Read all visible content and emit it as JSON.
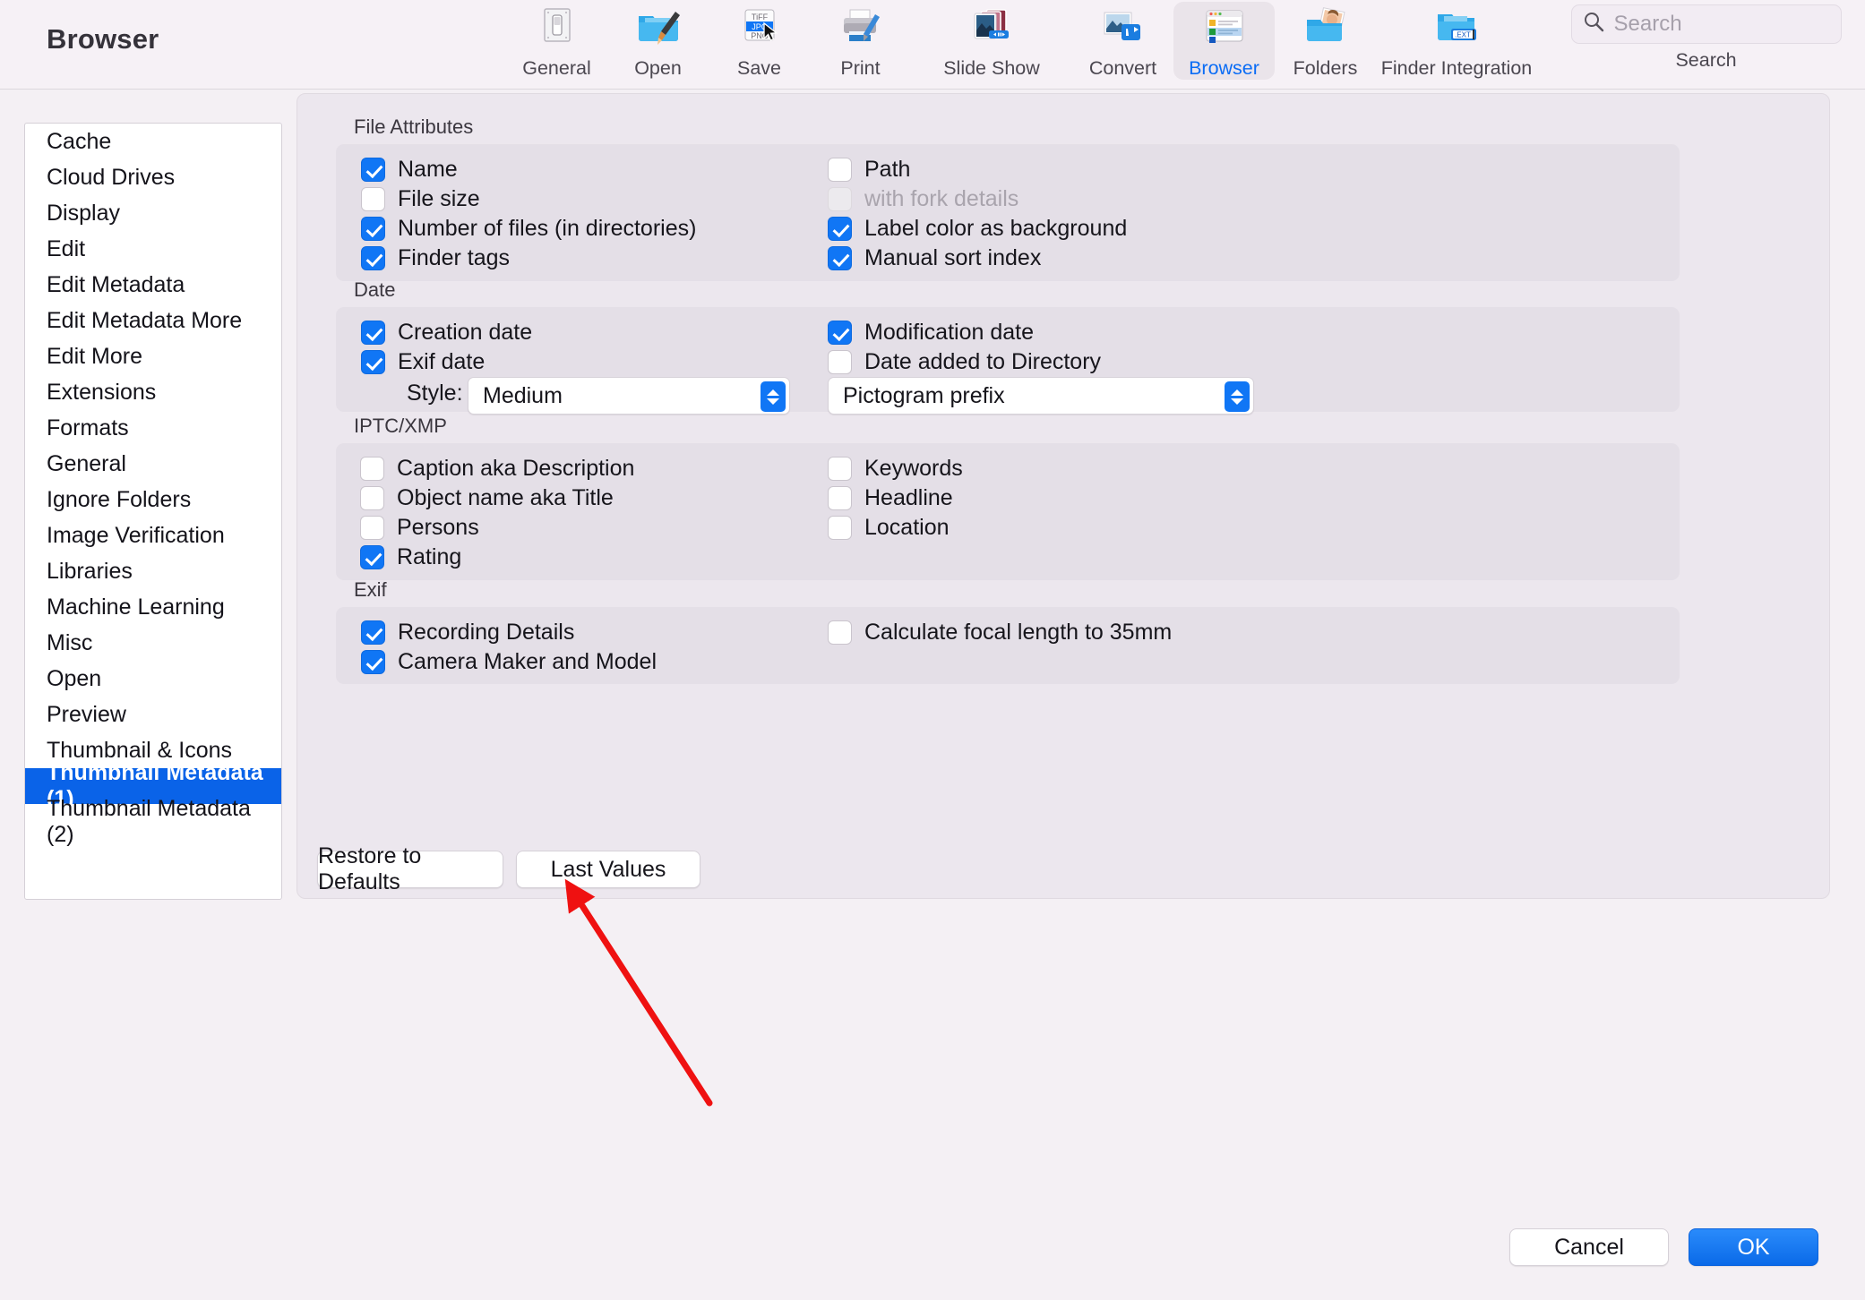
{
  "window": {
    "title": "Browser"
  },
  "toolbar": {
    "items": [
      {
        "label": "General",
        "icon": "general-switch-icon",
        "selected": false
      },
      {
        "label": "Open",
        "icon": "open-folder-brush-icon",
        "selected": false
      },
      {
        "label": "Save",
        "icon": "save-formats-icon",
        "selected": false
      },
      {
        "label": "Print",
        "icon": "printer-icon",
        "selected": false
      },
      {
        "label": "Slide Show",
        "icon": "slideshow-icon",
        "selected": false
      },
      {
        "label": "Convert",
        "icon": "convert-icon",
        "selected": false
      },
      {
        "label": "Browser",
        "icon": "browser-window-icon",
        "selected": true
      },
      {
        "label": "Folders",
        "icon": "folders-photo-icon",
        "selected": false
      },
      {
        "label": "Finder Integration",
        "icon": "finder-integration-icon",
        "selected": false
      }
    ],
    "search": {
      "placeholder": "Search",
      "value": "",
      "caption": "Search",
      "icon": "search-icon"
    }
  },
  "sidebar": {
    "items": [
      {
        "label": "Cache",
        "selected": false
      },
      {
        "label": "Cloud Drives",
        "selected": false
      },
      {
        "label": "Display",
        "selected": false
      },
      {
        "label": "Edit",
        "selected": false
      },
      {
        "label": "Edit Metadata",
        "selected": false
      },
      {
        "label": "Edit Metadata More",
        "selected": false
      },
      {
        "label": "Edit More",
        "selected": false
      },
      {
        "label": "Extensions",
        "selected": false
      },
      {
        "label": "Formats",
        "selected": false
      },
      {
        "label": "General",
        "selected": false
      },
      {
        "label": "Ignore Folders",
        "selected": false
      },
      {
        "label": "Image Verification",
        "selected": false
      },
      {
        "label": "Libraries",
        "selected": false
      },
      {
        "label": "Machine Learning",
        "selected": false
      },
      {
        "label": "Misc",
        "selected": false
      },
      {
        "label": "Open",
        "selected": false
      },
      {
        "label": "Preview",
        "selected": false
      },
      {
        "label": "Thumbnail & Icons",
        "selected": false
      },
      {
        "label": "Thumbnail Metadata (1)",
        "selected": true
      },
      {
        "label": "Thumbnail Metadata (2)",
        "selected": false
      }
    ]
  },
  "groups": {
    "file_attributes": {
      "title": "File Attributes",
      "left": [
        {
          "label": "Name",
          "checked": true,
          "disabled": false
        },
        {
          "label": "File size",
          "checked": false,
          "disabled": false
        },
        {
          "label": "Number of files (in directories)",
          "checked": true,
          "disabled": false
        },
        {
          "label": "Finder tags",
          "checked": true,
          "disabled": false
        }
      ],
      "right": [
        {
          "label": "Path",
          "checked": false,
          "disabled": false
        },
        {
          "label": "with fork details",
          "checked": false,
          "disabled": true
        },
        {
          "label": "Label color as background",
          "checked": true,
          "disabled": false
        },
        {
          "label": "Manual sort index",
          "checked": true,
          "disabled": false
        }
      ]
    },
    "date": {
      "title": "Date",
      "left": [
        {
          "label": "Creation date",
          "checked": true,
          "disabled": false
        },
        {
          "label": "Exif date",
          "checked": true,
          "disabled": false
        }
      ],
      "right": [
        {
          "label": "Modification date",
          "checked": true,
          "disabled": false
        },
        {
          "label": "Date added to Directory",
          "checked": false,
          "disabled": false
        }
      ],
      "style_label": "Style:",
      "style_value": "Medium",
      "pictogram_value": "Pictogram prefix"
    },
    "iptc_xmp": {
      "title": "IPTC/XMP",
      "left": [
        {
          "label": "Caption aka Description",
          "checked": false,
          "disabled": false
        },
        {
          "label": "Object name aka Title",
          "checked": false,
          "disabled": false
        },
        {
          "label": "Persons",
          "checked": false,
          "disabled": false
        },
        {
          "label": "Rating",
          "checked": true,
          "disabled": false
        }
      ],
      "right": [
        {
          "label": "Keywords",
          "checked": false,
          "disabled": false
        },
        {
          "label": "Headline",
          "checked": false,
          "disabled": false
        },
        {
          "label": "Location",
          "checked": false,
          "disabled": false
        }
      ]
    },
    "exif": {
      "title": "Exif",
      "left": [
        {
          "label": "Recording Details",
          "checked": true,
          "disabled": false
        },
        {
          "label": "Camera Maker and Model",
          "checked": true,
          "disabled": false
        }
      ],
      "right": [
        {
          "label": "Calculate focal length to 35mm",
          "checked": false,
          "disabled": false
        }
      ]
    }
  },
  "buttons": {
    "restore_defaults": "Restore to Defaults",
    "last_values": "Last Values",
    "cancel": "Cancel",
    "ok": "OK"
  },
  "annotation": {
    "type": "arrow",
    "color": "#ef1111",
    "points_at": "Camera Maker and Model"
  },
  "colors": {
    "accent": "#0a6cf5",
    "selection": "#0a63e8",
    "annotation": "#ef1111",
    "window_bg": "#f4f0f4",
    "panel_bg": "#ece7ee",
    "group_bg": "#e4dfe7"
  }
}
